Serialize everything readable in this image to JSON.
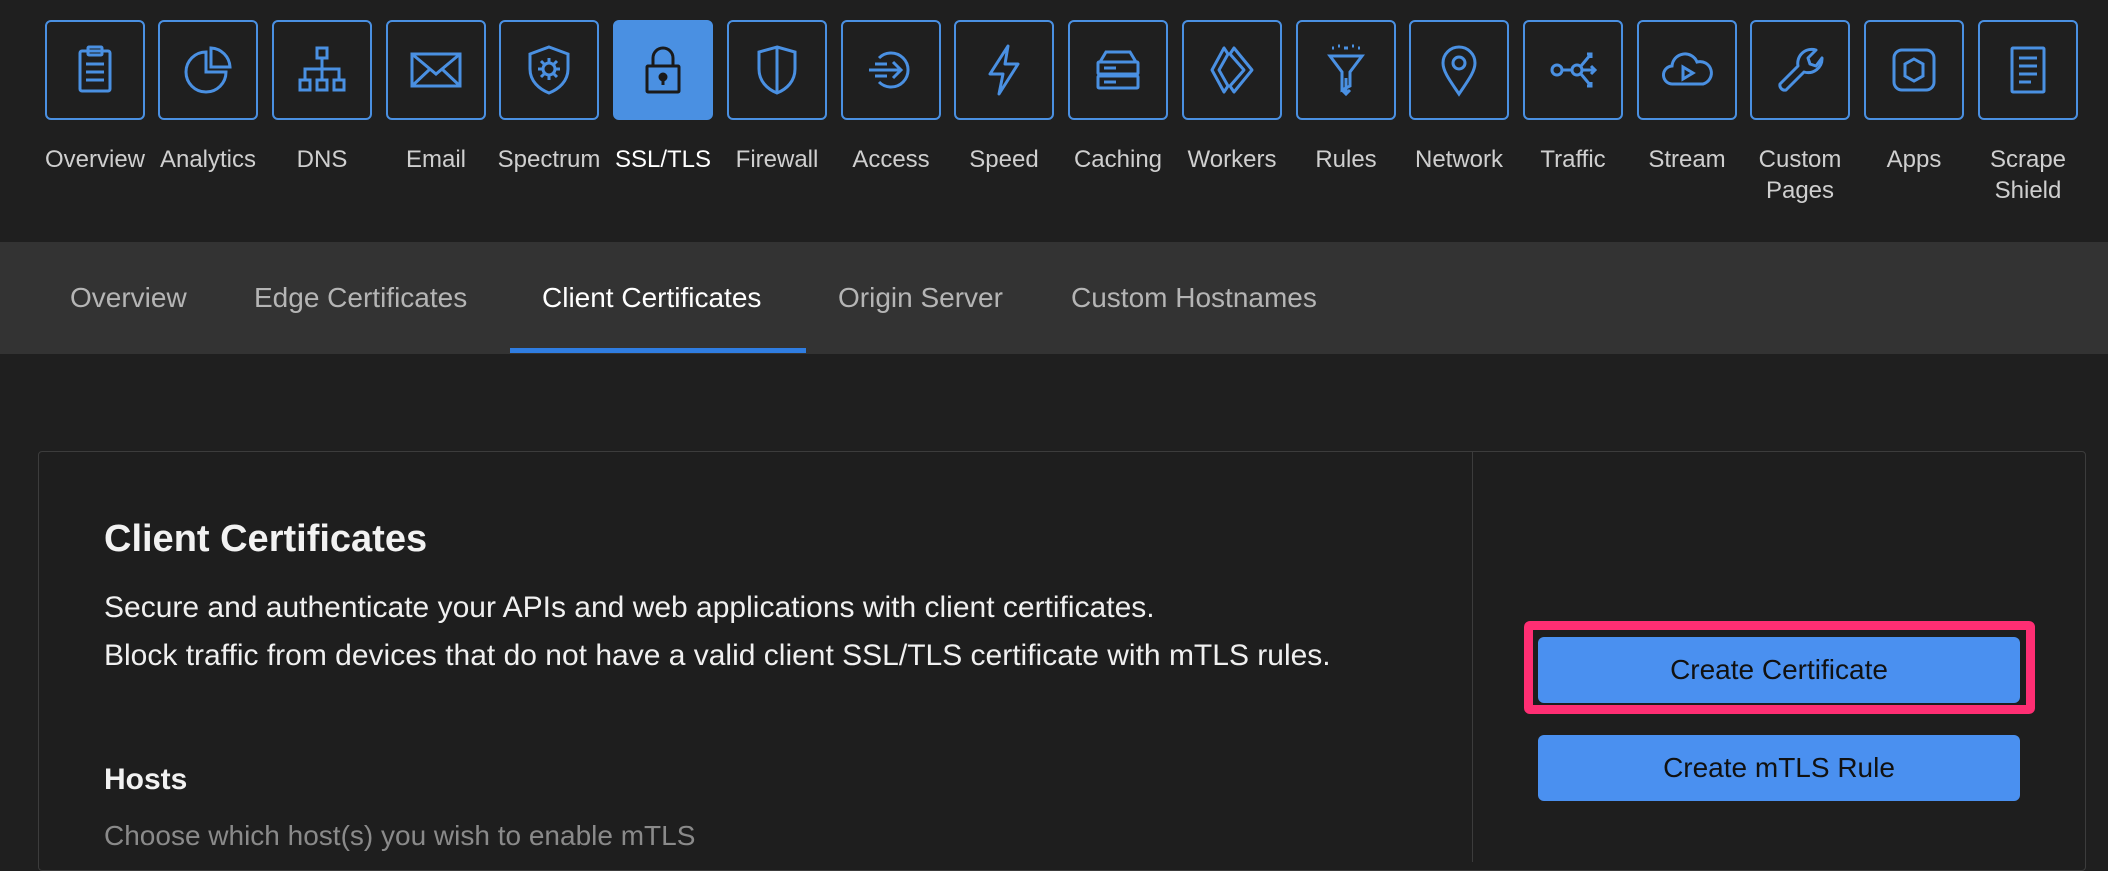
{
  "colors": {
    "accent": "#4a90e2",
    "highlight": "#ff2e73",
    "background": "#1f1f1f",
    "subnav_background": "#333333"
  },
  "top_nav": {
    "items": [
      {
        "label": "Overview",
        "icon": "clipboard-icon",
        "active": false
      },
      {
        "label": "Analytics",
        "icon": "pie-chart-icon",
        "active": false
      },
      {
        "label": "DNS",
        "icon": "sitemap-icon",
        "active": false
      },
      {
        "label": "Email",
        "icon": "envelope-icon",
        "active": false
      },
      {
        "label": "Spectrum",
        "icon": "shield-gear-icon",
        "active": false
      },
      {
        "label": "SSL/TLS",
        "icon": "lock-icon",
        "active": true
      },
      {
        "label": "Firewall",
        "icon": "shield-icon",
        "active": false
      },
      {
        "label": "Access",
        "icon": "sign-in-arrow-icon",
        "active": false
      },
      {
        "label": "Speed",
        "icon": "lightning-icon",
        "active": false
      },
      {
        "label": "Caching",
        "icon": "server-stack-icon",
        "active": false
      },
      {
        "label": "Workers",
        "icon": "chevrons-icon",
        "active": false
      },
      {
        "label": "Rules",
        "icon": "filter-funnel-icon",
        "active": false
      },
      {
        "label": "Network",
        "icon": "map-pin-icon",
        "active": false
      },
      {
        "label": "Traffic",
        "icon": "share-nodes-icon",
        "active": false
      },
      {
        "label": "Stream",
        "icon": "cloud-play-icon",
        "active": false
      },
      {
        "label": "Custom Pages",
        "icon": "wrench-icon",
        "active": false
      },
      {
        "label": "Apps",
        "icon": "hexagon-icon",
        "active": false
      },
      {
        "label": "Scrape Shield",
        "icon": "document-icon",
        "active": false
      }
    ]
  },
  "sub_tabs": [
    {
      "label": "Overview",
      "active": false
    },
    {
      "label": "Edge Certificates",
      "active": false
    },
    {
      "label": "Client Certificates",
      "active": true
    },
    {
      "label": "Origin Server",
      "active": false
    },
    {
      "label": "Custom Hostnames",
      "active": false
    }
  ],
  "card": {
    "title": "Client Certificates",
    "description_line1": "Secure and authenticate your APIs and web applications with client certificates.",
    "description_line2": "Block traffic from devices that do not have a valid client SSL/TLS certificate with mTLS rules.",
    "hosts_title": "Hosts",
    "hosts_subtitle": "Choose which host(s) you wish to enable mTLS",
    "create_certificate_label": "Create Certificate",
    "create_mtls_rule_label": "Create mTLS Rule"
  }
}
